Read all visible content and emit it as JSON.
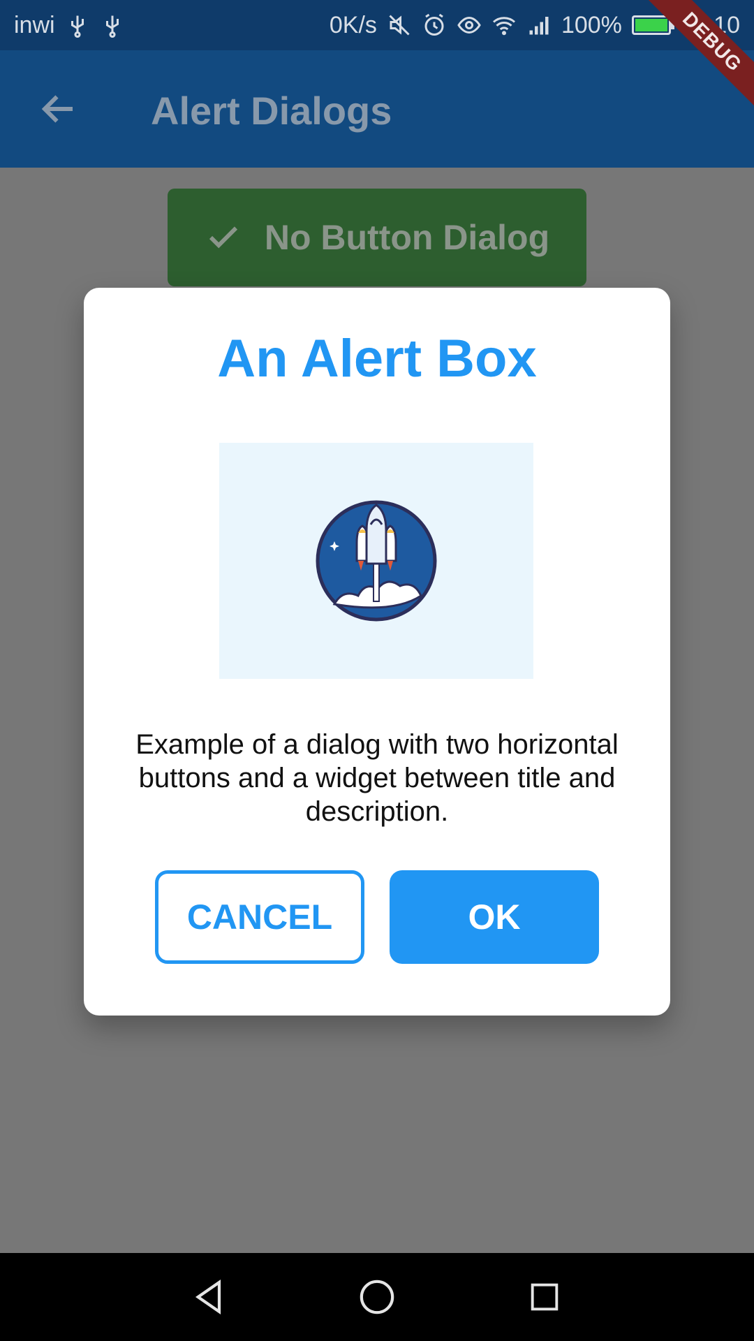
{
  "status_bar": {
    "carrier": "inwi",
    "speed": "0K/s",
    "battery": "100%",
    "time": "20:10",
    "battery_level": 1.0,
    "icons": [
      "usb-icon",
      "usb-icon",
      "mute-icon",
      "alarm-icon",
      "eye-icon",
      "wifi-icon",
      "signal-icon",
      "battery-icon"
    ]
  },
  "debug_banner": "DEBUG",
  "app_bar": {
    "title": "Alert Dialogs",
    "back_icon": "arrow-left-icon"
  },
  "page": {
    "no_button_dialog_label": "No Button Dialog",
    "check_icon": "check-icon"
  },
  "dialog": {
    "title": "An Alert Box",
    "illustration": "rocket-launch-illustration",
    "description": "Example of a dialog with two horizontal buttons and a widget between title and description.",
    "cancel_label": "CANCEL",
    "ok_label": "OK"
  },
  "colors": {
    "accent": "#2196F3",
    "app_bar": "#124A80",
    "status_bar": "#0F3B6A",
    "scrim": "#777777",
    "green_button": "#2D5E2F"
  },
  "nav_bar": {
    "icons": [
      "back-triangle-icon",
      "home-circle-icon",
      "recents-square-icon"
    ]
  }
}
